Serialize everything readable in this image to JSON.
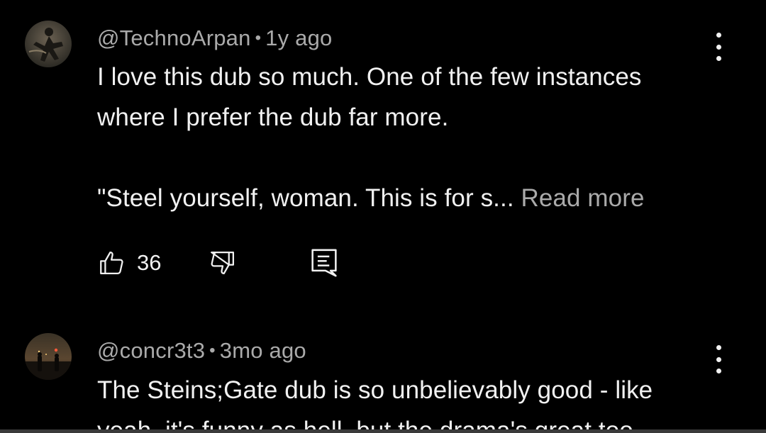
{
  "comments": [
    {
      "author": "@TechnoArpan",
      "separator": "•",
      "time": "1y ago",
      "lines": [
        "I love this dub so much. One of the few instances",
        "where I prefer the dub far more.",
        "",
        "\"Steel yourself, woman. This is for s..."
      ],
      "read_more": "Read more",
      "likes": "36",
      "avatar_icon": "figure-silhouette-avatar"
    },
    {
      "author": "@concr3t3",
      "separator": "•",
      "time": "3mo ago",
      "lines": [
        "The Steins;Gate dub is so unbelievably good - like",
        "yeah, it's funny as hell, but the drama's great too"
      ],
      "avatar_icon": "night-scene-avatar"
    }
  ],
  "icons": {
    "like": "thumbs-up-icon",
    "dislike": "thumbs-down-icon",
    "reply": "reply-icon",
    "more": "more-vert-icon"
  },
  "colors": {
    "background": "#000000",
    "text": "#f1f1f1",
    "secondary": "#aaaaaa"
  }
}
